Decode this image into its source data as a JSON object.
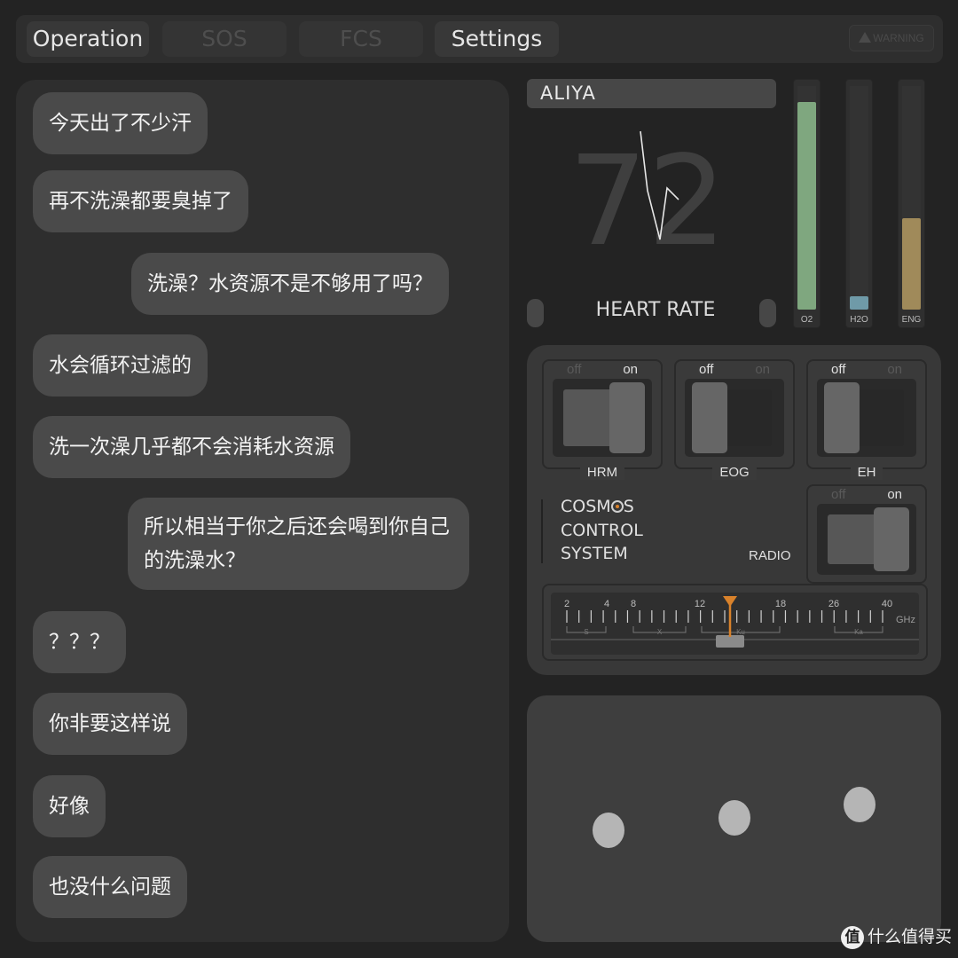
{
  "nav": {
    "tabs": [
      {
        "label": "Operation",
        "active": true
      },
      {
        "label": "SOS",
        "active": false
      },
      {
        "label": "FCS",
        "active": false
      },
      {
        "label": "Settings",
        "active": true
      }
    ],
    "warning_label": "WARNING"
  },
  "chat": {
    "messages": [
      {
        "side": "left",
        "text": "今天出了不少汗"
      },
      {
        "side": "left",
        "text": "再不洗澡都要臭掉了"
      },
      {
        "side": "right",
        "text": "洗澡？水资源不是不够用了吗？"
      },
      {
        "side": "left",
        "text": "水会循环过滤的"
      },
      {
        "side": "left",
        "text": "洗一次澡几乎都不会消耗水资源"
      },
      {
        "side": "right",
        "text": "所以相当于你之后还会喝到你自己的洗澡水？"
      },
      {
        "side": "left",
        "text": "？？？"
      },
      {
        "side": "left",
        "text": "你非要这样说"
      },
      {
        "side": "left",
        "text": "好像"
      },
      {
        "side": "left",
        "text": "也没什么问题"
      }
    ]
  },
  "monitor": {
    "name": "ALIYA",
    "heart_rate": "72",
    "heart_rate_label": "HEART RATE",
    "gauges": [
      {
        "label": "O2",
        "level": 0.93,
        "color": "#7fa77f"
      },
      {
        "label": "H2O",
        "level": 0.06,
        "color": "#6f9aa8"
      },
      {
        "label": "ENG",
        "level": 0.41,
        "color": "#a08a5a"
      }
    ]
  },
  "controls": {
    "switches": [
      {
        "name": "HRM",
        "state": "on",
        "off_label": "off",
        "on_label": "on"
      },
      {
        "name": "EOG",
        "state": "off",
        "off_label": "off",
        "on_label": "on"
      },
      {
        "name": "EH",
        "state": "off",
        "off_label": "off",
        "on_label": "on"
      }
    ],
    "system_title": [
      "COSMOS",
      "CONTROL",
      "SYSTEM"
    ],
    "radio": {
      "label": "RADIO",
      "state": "on",
      "off_label": "off",
      "on_label": "on"
    },
    "tuner": {
      "ticks": [
        "2",
        "4",
        "8",
        "12",
        "18",
        "26",
        "40"
      ],
      "unit": "GHz",
      "bands": [
        "S",
        "X",
        "Ku",
        "Ka"
      ],
      "accent": "#d9822b"
    }
  },
  "watermark": {
    "logo": "值",
    "text": "什么值得买"
  }
}
